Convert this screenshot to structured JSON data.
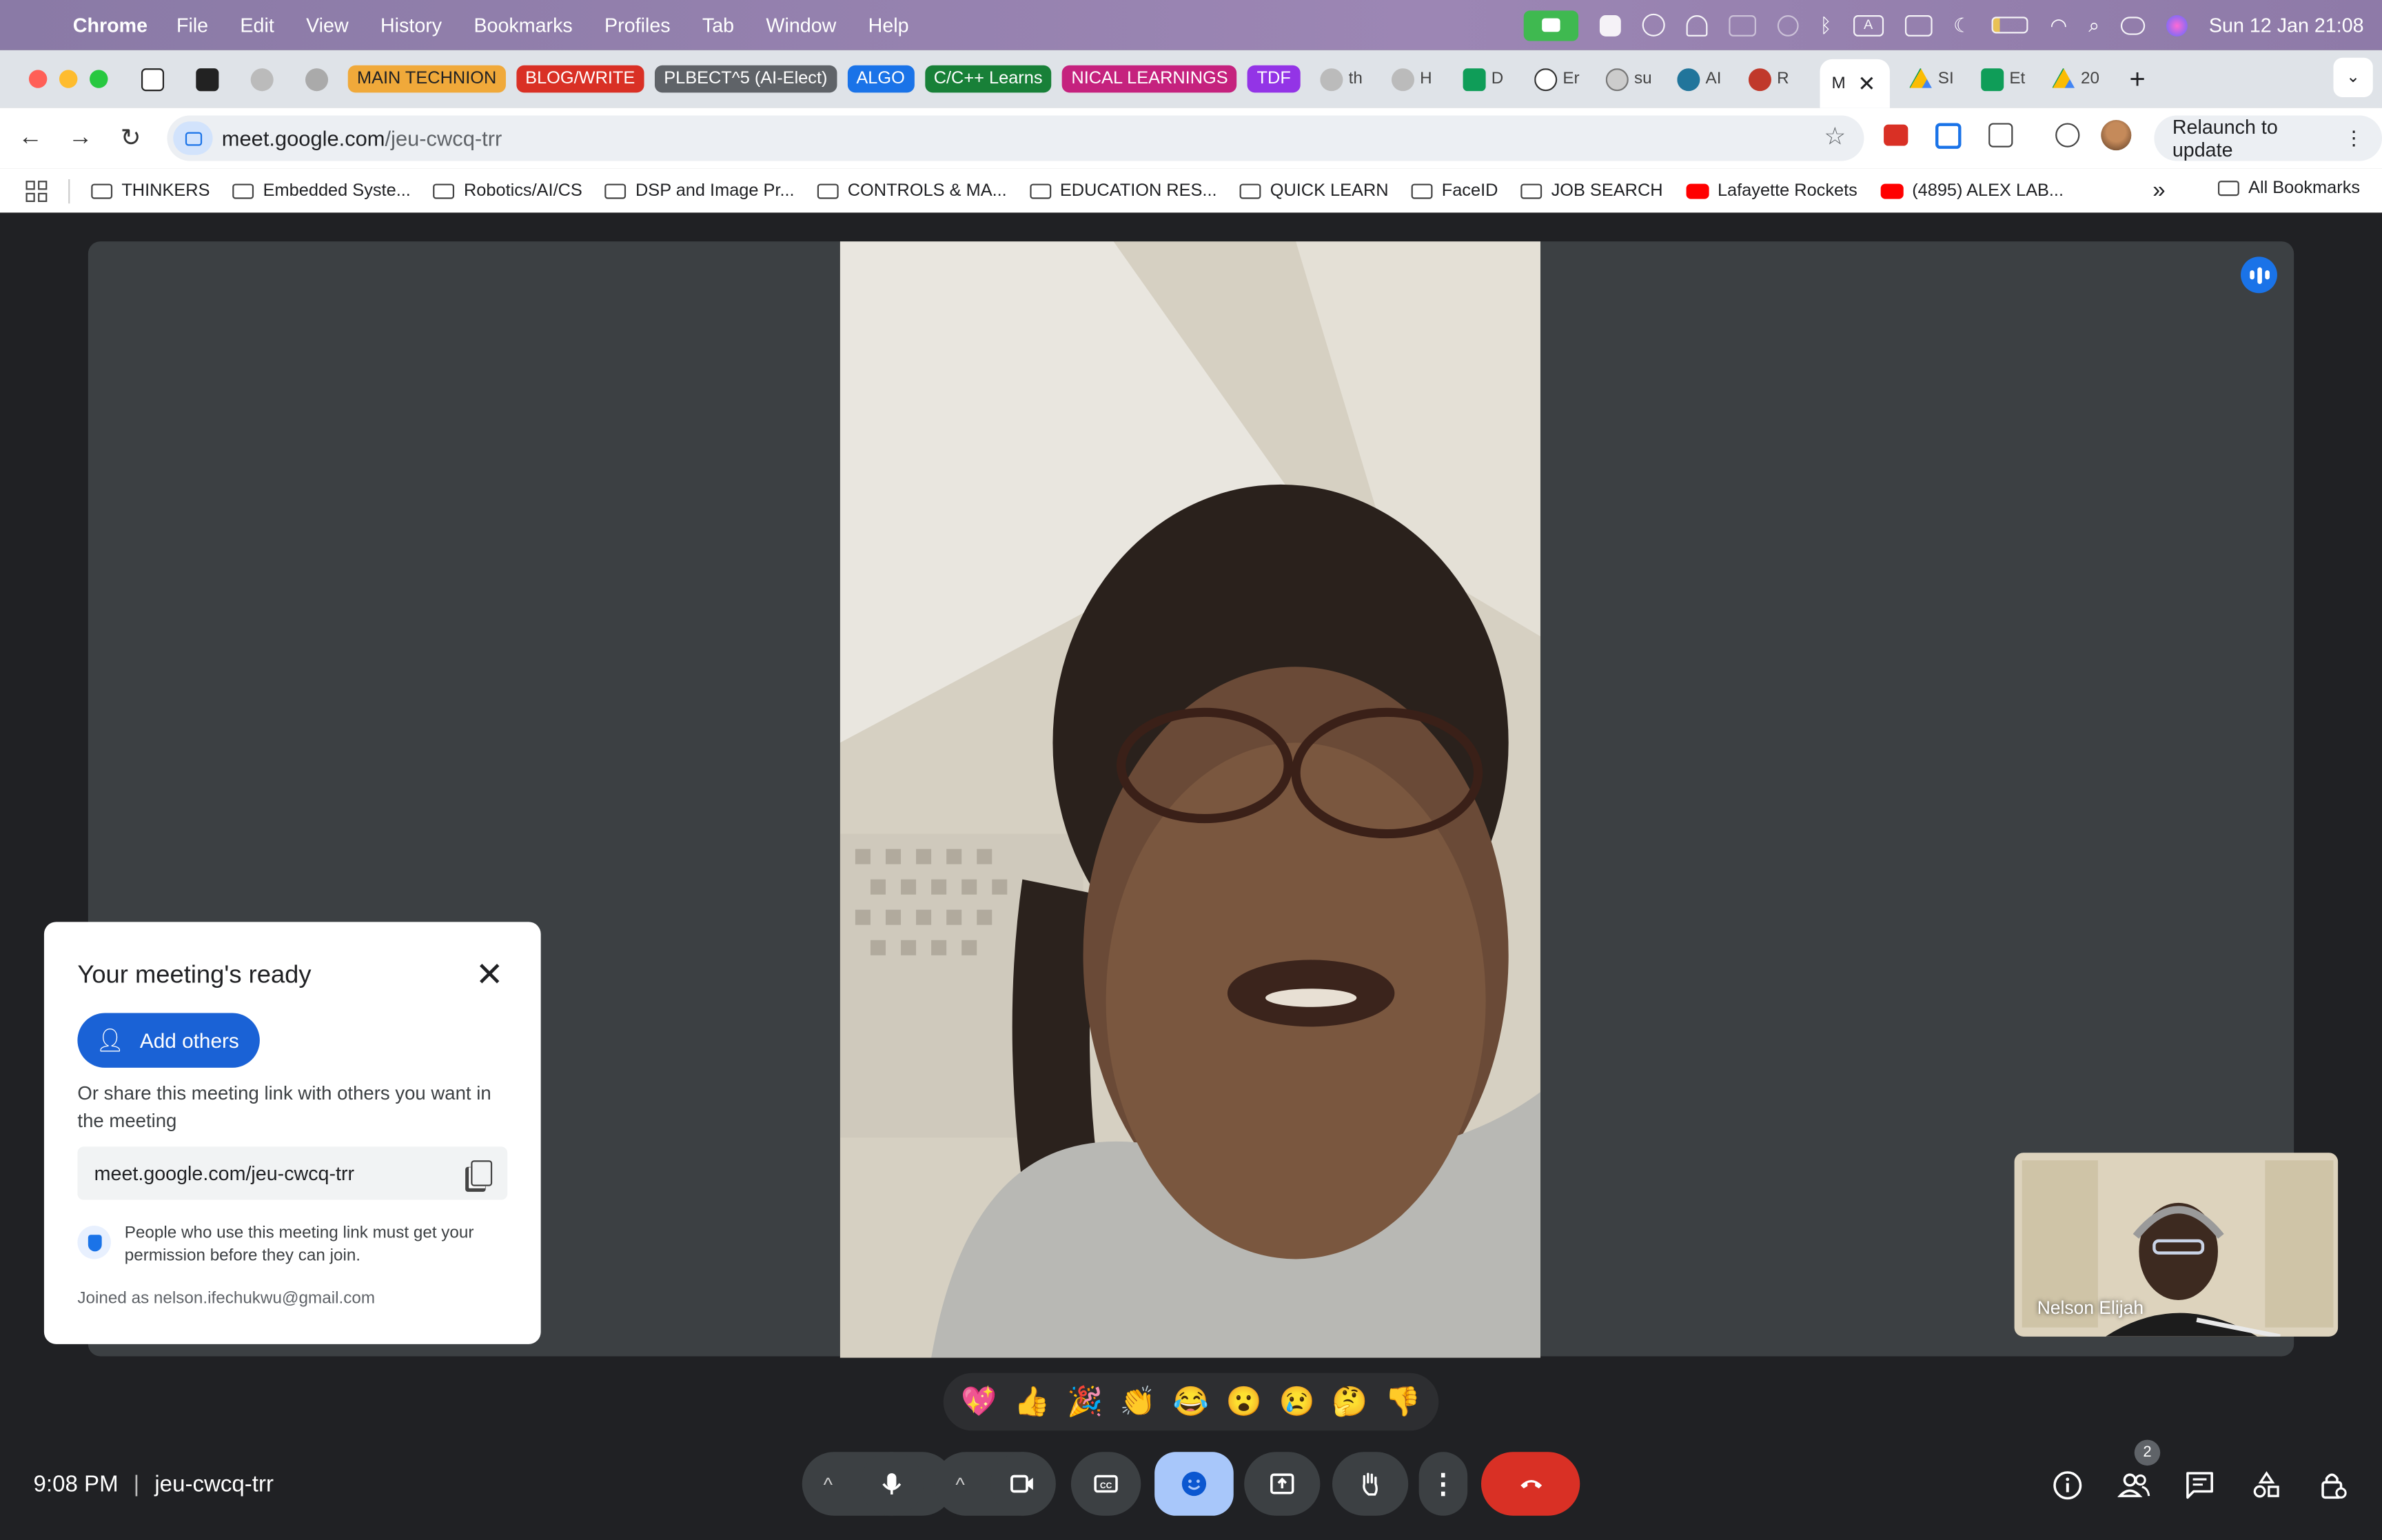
{
  "menubar": {
    "app_name": "Chrome",
    "items": [
      "File",
      "Edit",
      "View",
      "History",
      "Bookmarks",
      "Profiles",
      "Tab",
      "Window",
      "Help"
    ],
    "datetime": "Sun 12 Jan  21:08"
  },
  "tabs": {
    "groups": [
      {
        "label": "MAIN TECHNION",
        "color": "#f0a93a",
        "text": "#202124"
      },
      {
        "label": "BLOG/WRITE",
        "color": "#d93025",
        "text": "#ffffff"
      },
      {
        "label": "PLBECT^5 (AI-Elect)",
        "color": "#5f6368",
        "text": "#ffffff"
      },
      {
        "label": "ALGO",
        "color": "#1a73e8",
        "text": "#ffffff"
      },
      {
        "label": "C/C++ Learns",
        "color": "#188038",
        "text": "#ffffff"
      },
      {
        "label": "NICAL LEARNINGS",
        "color": "#c5227e",
        "text": "#ffffff"
      },
      {
        "label": "TDF",
        "color": "#9334e6",
        "text": "#ffffff"
      }
    ],
    "tail_tabs": [
      {
        "label": "th",
        "icon": "globe-icon"
      },
      {
        "label": "H",
        "icon": "globe-icon"
      },
      {
        "label": "D",
        "icon": "sheets-icon"
      },
      {
        "label": "Er",
        "icon": "wikipedia-icon"
      },
      {
        "label": "su",
        "icon": "globe-icon"
      },
      {
        "label": "AI",
        "icon": "wordpress-icon"
      },
      {
        "label": "R",
        "icon": "site-icon"
      }
    ],
    "active_tab_label": "M",
    "after_tabs": [
      {
        "label": "SI",
        "icon": "drive-icon"
      },
      {
        "label": "Et",
        "icon": "sheets-icon"
      },
      {
        "label": "20",
        "icon": "drive-icon"
      }
    ],
    "new_tab": "+"
  },
  "toolbar": {
    "url_host": "meet.google.com",
    "url_path": "/jeu-cwcq-trr",
    "relaunch_label": "Relaunch to update"
  },
  "bookmarks": [
    {
      "label": "THINKERS",
      "type": "folder"
    },
    {
      "label": "Embedded Syste...",
      "type": "folder"
    },
    {
      "label": "Robotics/AI/CS",
      "type": "folder"
    },
    {
      "label": "DSP and Image Pr...",
      "type": "folder"
    },
    {
      "label": "CONTROLS & MA...",
      "type": "folder"
    },
    {
      "label": "EDUCATION RES...",
      "type": "folder"
    },
    {
      "label": "QUICK LEARN",
      "type": "folder"
    },
    {
      "label": "FaceID",
      "type": "folder"
    },
    {
      "label": "JOB SEARCH",
      "type": "folder"
    },
    {
      "label": "Lafayette Rockets",
      "type": "youtube"
    },
    {
      "label": "(4895) ALEX LAB...",
      "type": "youtube"
    }
  ],
  "bookmarks_more": "»",
  "bookmarks_all": "All Bookmarks",
  "meeting_card": {
    "title": "Your meeting's ready",
    "add_others": "Add others",
    "share_text": "Or share this meeting link with others you want in the meeting",
    "link": "meet.google.com/jeu-cwcq-trr",
    "permission_text": "People who use this meeting link must get your permission before they can join.",
    "joined_as": "Joined as nelson.ifechukwu@gmail.com"
  },
  "self_view": {
    "name": "Nelson Elijah"
  },
  "reactions": [
    "💖",
    "👍",
    "🎉",
    "👏",
    "😂",
    "😮",
    "😢",
    "🤔",
    "👎"
  ],
  "bottom": {
    "time": "9:08 PM",
    "meeting_code": "jeu-cwcq-trr",
    "participants_count": "2"
  },
  "colors": {
    "meet_bg": "#202124",
    "stage_bg": "#3c4043",
    "accent_blue": "#1a62d6",
    "end_call_red": "#d93025",
    "reactions_active": "#a8c7fa"
  }
}
